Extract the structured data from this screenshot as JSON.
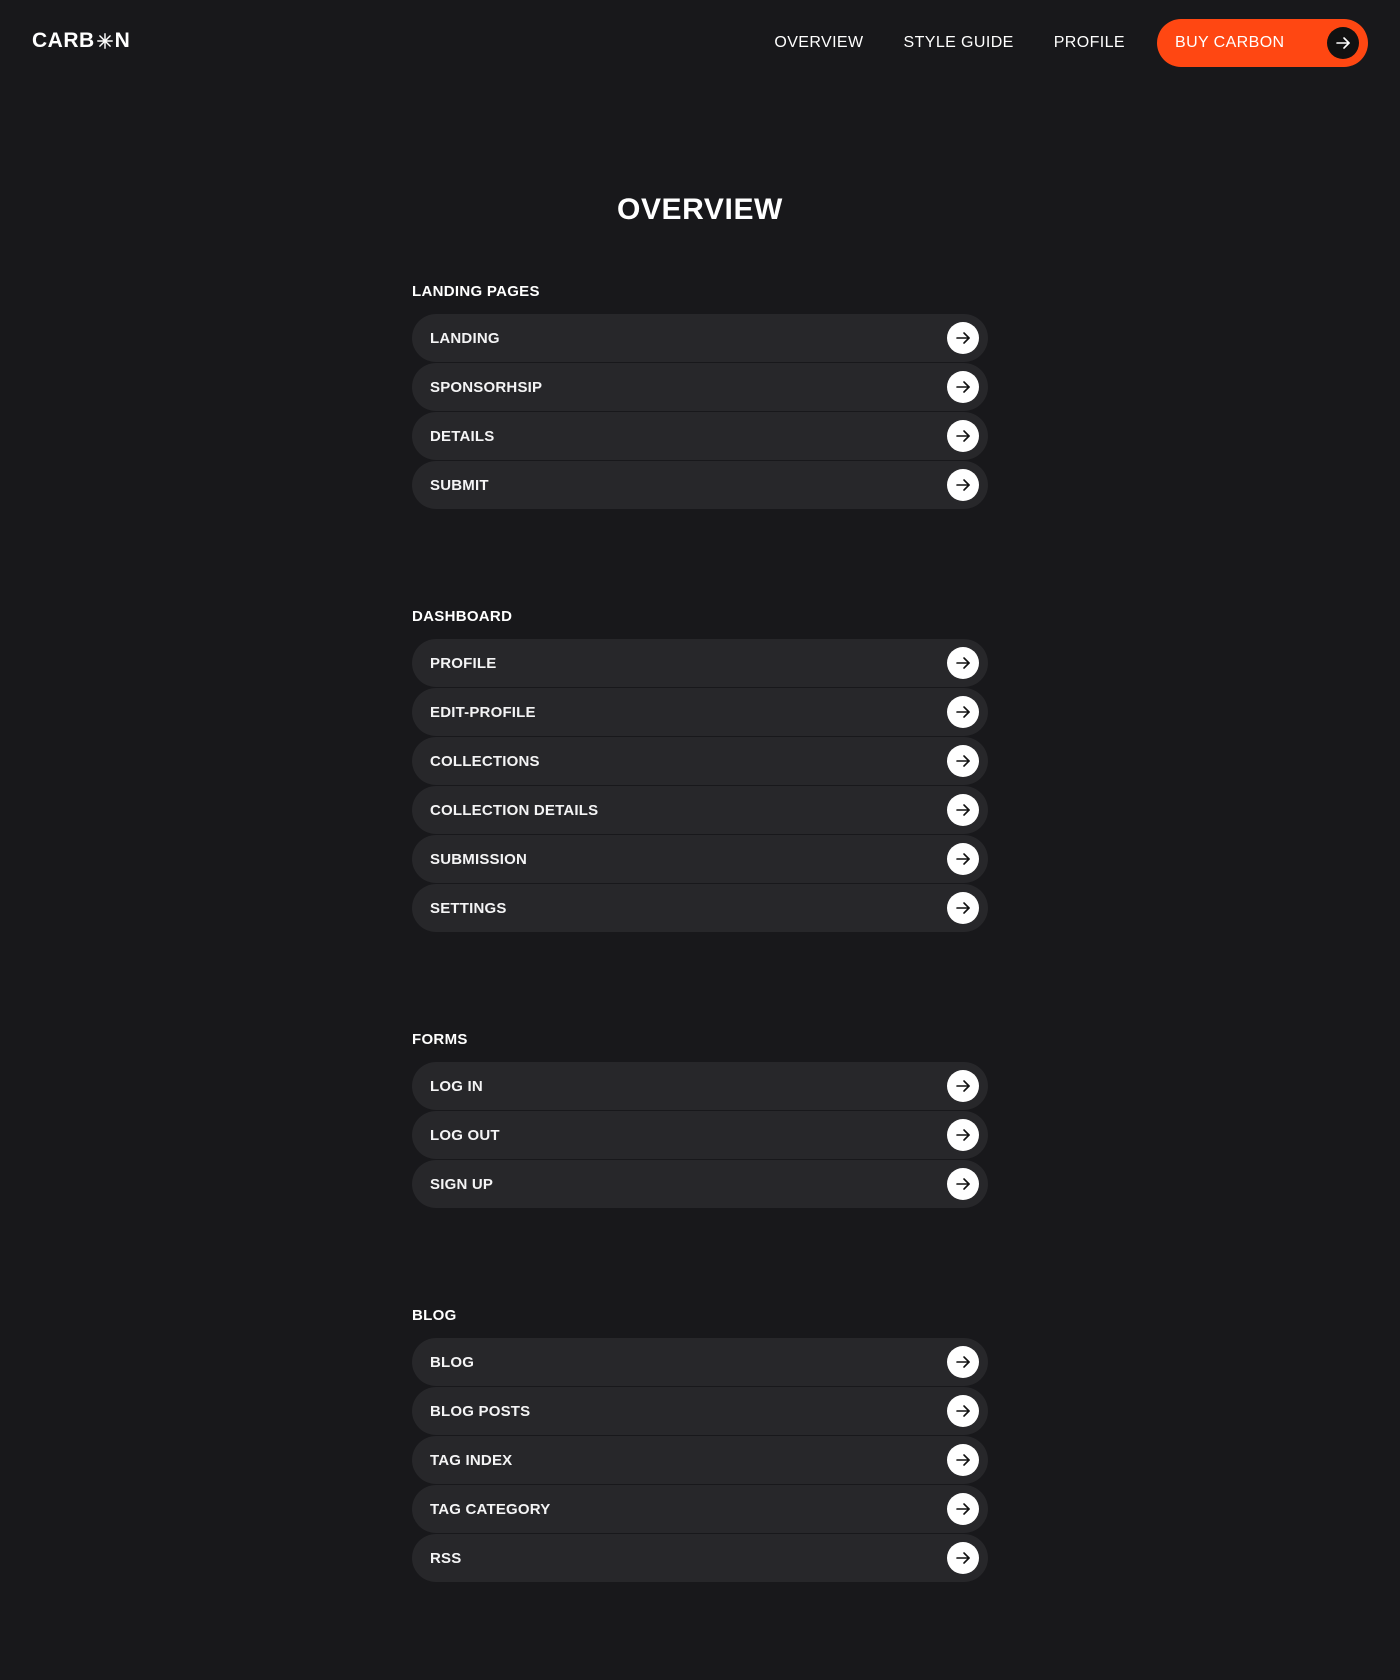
{
  "header": {
    "logo_text_start": "CARB",
    "logo_text_end": "N",
    "logo_icon": "asterisk-icon",
    "nav": [
      {
        "label": "OVERVIEW"
      },
      {
        "label": "STYLE GUIDE"
      },
      {
        "label": "PROFILE"
      }
    ],
    "cta": {
      "label": "BUY CARBON",
      "icon": "arrow-right-icon"
    }
  },
  "colors": {
    "background": "#18181b",
    "row": "#27272a",
    "accent": "#ff4712"
  },
  "main": {
    "title": "OVERVIEW",
    "sections": [
      {
        "title": "LANDING PAGES",
        "items": [
          {
            "label": "LANDING"
          },
          {
            "label": "SPONSORHSIP"
          },
          {
            "label": "DETAILS"
          },
          {
            "label": "SUBMIT"
          }
        ]
      },
      {
        "title": "DASHBOARD",
        "items": [
          {
            "label": "PROFILE"
          },
          {
            "label": "EDIT-PROFILE"
          },
          {
            "label": "COLLECTIONS"
          },
          {
            "label": "COLLECTION DETAILS"
          },
          {
            "label": "SUBMISSION"
          },
          {
            "label": "SETTINGS"
          }
        ]
      },
      {
        "title": "FORMS",
        "items": [
          {
            "label": "LOG IN"
          },
          {
            "label": "LOG OUT"
          },
          {
            "label": "SIGN UP"
          }
        ]
      },
      {
        "title": "BLOG",
        "items": [
          {
            "label": "BLOG"
          },
          {
            "label": "BLOG POSTS"
          },
          {
            "label": "TAG INDEX"
          },
          {
            "label": "TAG CATEGORY"
          },
          {
            "label": "RSS"
          }
        ]
      }
    ]
  }
}
